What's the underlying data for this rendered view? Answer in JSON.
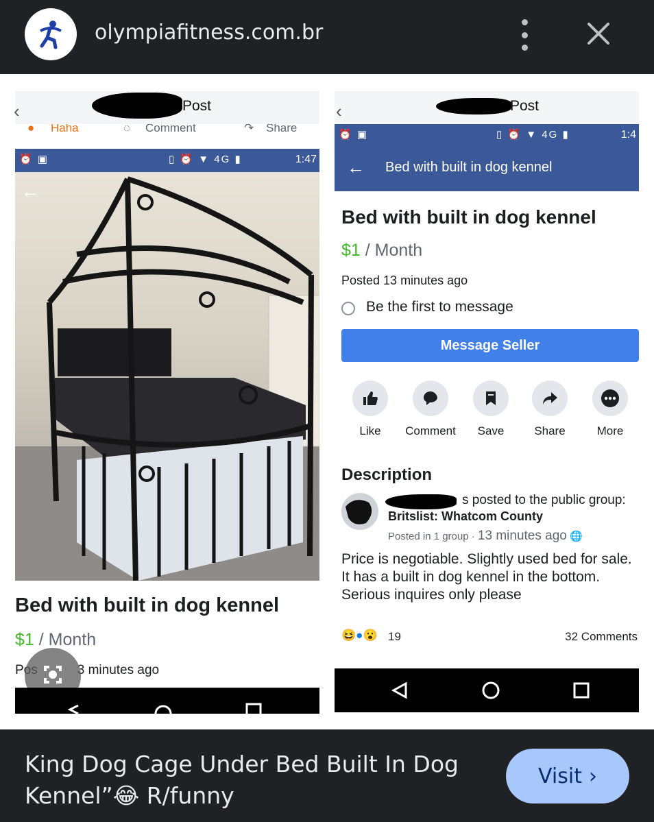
{
  "browser": {
    "url": "olympiafitness.com.br",
    "menu_icon": "more-vert-icon",
    "close_icon": "close-icon"
  },
  "left_post": {
    "header_title": "Post",
    "reaction_labels": [
      "Haha",
      "Comment",
      "Share"
    ],
    "status_time": "1:47",
    "status_network": "4G",
    "listing_title": "Bed with built in dog kennel",
    "price_amount": "$1",
    "price_period": " / Month",
    "posted_fragment": "3 minutes ago",
    "posted_prefix": "Pos"
  },
  "right_post": {
    "header_title": "Post",
    "status_time": "1:4",
    "status_network": "4G",
    "bar_title": "Bed with built in dog kennel",
    "listing_title": "Bed with built in dog kennel",
    "price_amount": "$1",
    "price_period": " / Month",
    "posted": "Posted 13 minutes ago",
    "first_message": "Be the first to message",
    "message_button": "Message Seller",
    "actions": [
      {
        "label": "Like",
        "icon": "like-icon"
      },
      {
        "label": "Comment",
        "icon": "comment-icon"
      },
      {
        "label": "Save",
        "icon": "bookmark-icon"
      },
      {
        "label": "Share",
        "icon": "share-icon"
      },
      {
        "label": "More",
        "icon": "more-horiz-icon"
      }
    ],
    "description_heading": "Description",
    "group_action": "s posted to the public group:",
    "group_name": "Britslist: Whatcom County",
    "group_meta_prefix": "Posted in 1 group · ",
    "group_meta_time": "13 minutes ago",
    "description": "Price is negotiable. Slightly used bed for sale. It has a built in dog kennel in the bottom. Serious inquires only please",
    "reaction_count": "19",
    "comments_count": "32 Comments"
  },
  "result": {
    "caption": "King Dog Cage Under Bed Built In Dog Kennel”😂 R/funny",
    "visit_label": "Visit"
  },
  "colors": {
    "facebook_blue": "#3b5998",
    "button_blue": "#4080e8",
    "price_green": "#42b72a",
    "visit_bg": "#a8c7fa"
  }
}
